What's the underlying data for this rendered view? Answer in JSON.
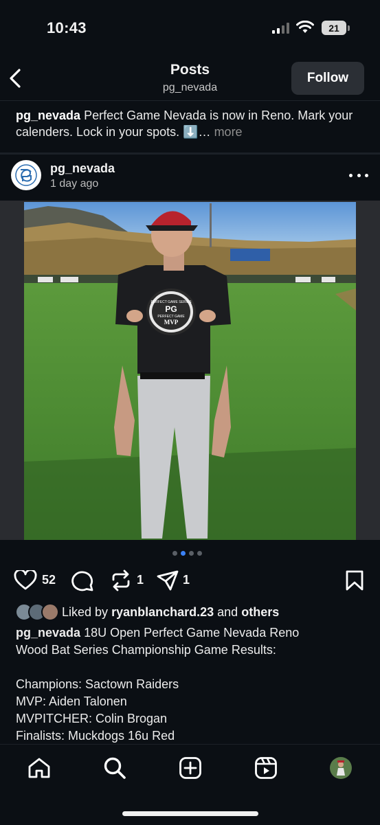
{
  "status_bar": {
    "time": "10:43",
    "battery": "21"
  },
  "header": {
    "title": "Posts",
    "subtitle": "pg_nevada",
    "follow_label": "Follow"
  },
  "previous_post": {
    "username": "pg_nevada",
    "caption": "Perfect Game Nevada is now in Reno. Mark your calenders. Lock in your spots. ⬇️…",
    "more_label": "more"
  },
  "post": {
    "username": "pg_nevada",
    "timestamp": "1 day ago",
    "avatar_icon": "perfect-game-logo",
    "photo": {
      "plaque_lines": [
        "PERFECT GAME SERIES",
        "PG",
        "PERFECT GAME",
        "MVP"
      ],
      "image_slides": 4,
      "active_slide": 2
    },
    "actions": {
      "likes": "52",
      "reposts": "1",
      "shares": "1"
    },
    "liked_by": {
      "prefix": "Liked by",
      "user": "ryanblanchard.23",
      "joiner": "and",
      "others": "others"
    },
    "caption_user": "pg_nevada",
    "caption_lines": [
      "18U Open Perfect Game Nevada Reno",
      "Wood Bat Series Championship Game Results:",
      "",
      "Champions:  Sactown Raiders",
      "MVP: Aiden Talonen",
      "MVPITCHER: Colin Brogan",
      "Finalists: Muckdogs 16u Red"
    ]
  },
  "nav": {
    "items": [
      "home-icon",
      "search-icon",
      "create-icon",
      "reels-icon",
      "profile-avatar"
    ]
  },
  "colors": {
    "background": "#0b0f14",
    "follow_button": "#2b2f35",
    "active_dot": "#3b82f6"
  }
}
